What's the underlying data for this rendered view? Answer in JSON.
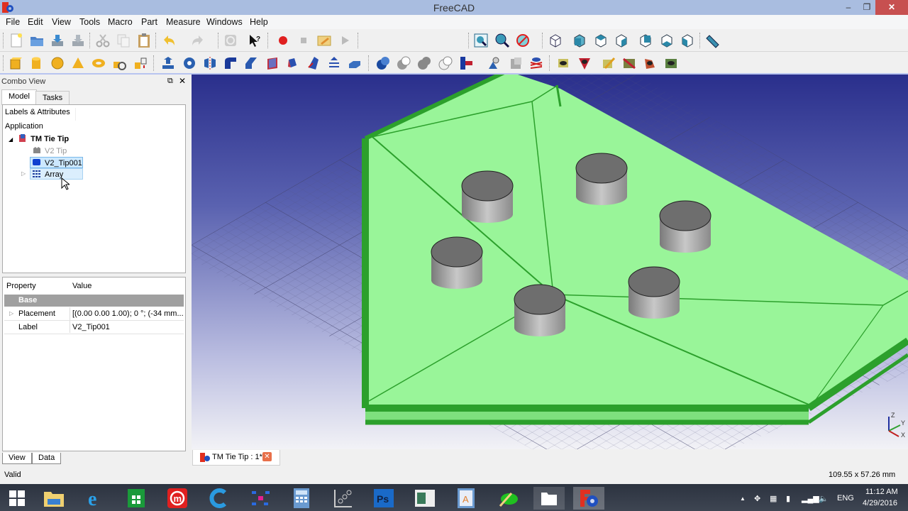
{
  "window": {
    "title": "FreeCAD",
    "minimize": "–",
    "restore": "❐",
    "close": "✕"
  },
  "menu": [
    "File",
    "Edit",
    "View",
    "Tools",
    "Macro",
    "Part",
    "Measure",
    "Windows",
    "Help"
  ],
  "toolbar1": {
    "icons": [
      "new-document",
      "open-document",
      "save-document",
      "save-as",
      "cut",
      "copy",
      "paste",
      "undo",
      "undo-dropdown",
      "redo",
      "redo-dropdown",
      "refresh",
      "whats-this",
      "macro-record",
      "macro-stop",
      "macro-edit",
      "macro-execute",
      "view-fit-all",
      "view-fit-selection",
      "draw-style",
      "view-isometric",
      "view-front",
      "view-top",
      "view-right",
      "view-rear",
      "view-bottom",
      "view-left",
      "measure-distance"
    ],
    "workbench": "Part"
  },
  "toolbar2": {
    "icons": [
      "part-box",
      "part-cylinder",
      "part-sphere",
      "part-cone",
      "part-torus",
      "part-primitives",
      "part-shape-builder",
      "part-extrude",
      "part-revolve",
      "part-mirror",
      "part-fillet",
      "part-chamfer",
      "part-make-face",
      "part-ruled-surface",
      "part-loft",
      "part-sweep",
      "part-section",
      "part-cross-sections",
      "boolean",
      "cut",
      "fuse",
      "common",
      "join-features",
      "check-geometry",
      "defeaturing",
      "part-offset",
      "part-thickness",
      "measure-linear",
      "measure-angular",
      "measure-refresh",
      "measure-clear",
      "measure-toggle-3d",
      "measure-toggle-delta"
    ]
  },
  "combo": {
    "title": "Combo View",
    "tabs": [
      "Model",
      "Tasks"
    ],
    "tree": {
      "header": "Labels & Attributes",
      "root": "Application",
      "document": "TM Tie Tip",
      "items": [
        {
          "label": "V2 Tip",
          "icon": "hidden-body-icon",
          "visible": false
        },
        {
          "label": "V2_Tip001",
          "icon": "solid-icon",
          "selected": true
        },
        {
          "label": "Array",
          "icon": "array-icon",
          "selected": true,
          "expandable": true
        }
      ]
    },
    "properties": {
      "col_property": "Property",
      "col_value": "Value",
      "group": "Base",
      "rows": [
        {
          "name": "Placement",
          "value": "[(0.00 0.00 1.00); 0 °; (-34 mm...",
          "expandable": true
        },
        {
          "name": "Label",
          "value": "V2_Tip001"
        }
      ]
    },
    "bottom_tabs": [
      "View",
      "Data"
    ]
  },
  "viewport": {
    "axis_labels": {
      "x": "X",
      "y": "Y",
      "z": "Z"
    },
    "colors": {
      "body": "#99f599",
      "edge": "#2ca02c",
      "pin_top": "#6e6e6e",
      "pin_side": "#a8a8a8"
    }
  },
  "document_tab": {
    "label": "TM Tie Tip : 1*"
  },
  "status": {
    "message": "Valid",
    "dimensions": "109.55 x 57.26 mm"
  },
  "taskbar": {
    "apps": [
      "start",
      "file-explorer",
      "internet-explorer",
      "store",
      "makerbot",
      "ccleaner",
      "molecule-app",
      "calculator",
      "graph-app",
      "photoshop",
      "reader-app",
      "word-app",
      "sketch-app",
      "folder-app",
      "freecad"
    ],
    "tray": {
      "language": "ENG",
      "time": "11:12 AM",
      "date": "4/29/2016"
    }
  }
}
